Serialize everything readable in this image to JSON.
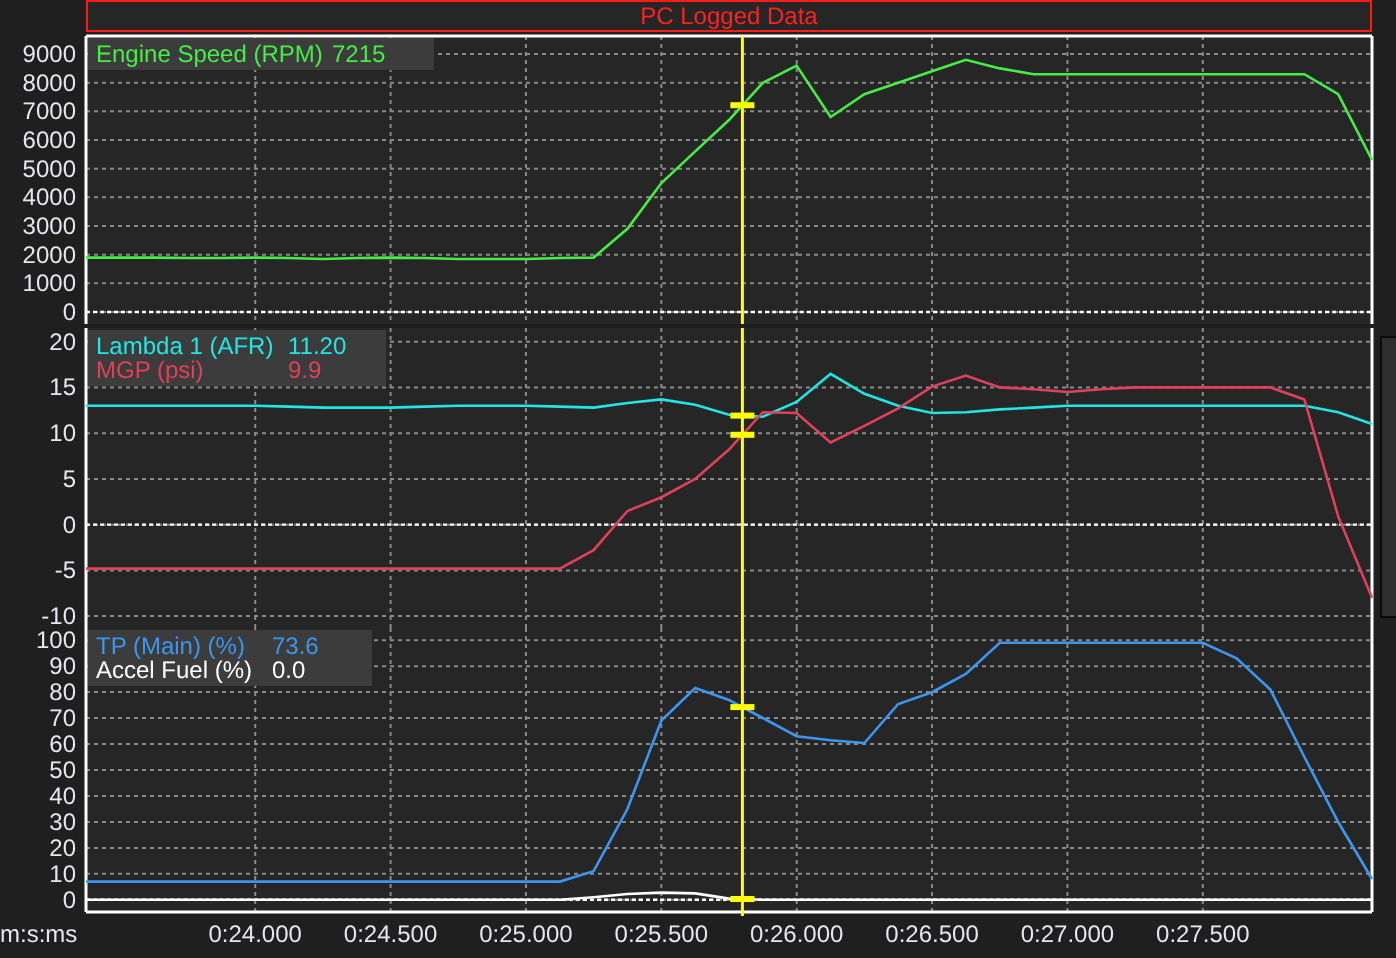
{
  "window": {
    "title": "PC Logged Data"
  },
  "panels": [
    {
      "readings": [
        "7215"
      ],
      "chart_data": {
        "type": "line",
        "series": [
          {
            "name": "Engine Speed (RPM)",
            "color": "#44ee44",
            "values": [
              1900,
              1900,
              1900,
              1880,
              1880,
              1900,
              1880,
              1850,
              1880,
              1900,
              1880,
              1850,
              1850,
              1850,
              1880,
              1900,
              2900,
              4500,
              5600,
              6700,
              8000,
              8600,
              6800,
              7600,
              8000,
              8400,
              8800,
              8500,
              8300,
              8300,
              8300,
              8300,
              8300,
              8300,
              8300,
              8300,
              8300,
              7600,
              5300
            ]
          }
        ],
        "ylim": [
          -420,
          9630
        ],
        "yticks": [
          0,
          1000,
          2000,
          3000,
          4000,
          5000,
          6000,
          7000,
          8000,
          9000
        ],
        "grid": true,
        "ref_lines": [
          {
            "axis": "y",
            "value": 0
          }
        ]
      }
    },
    {
      "readings": [
        "11.20",
        "9.9"
      ],
      "chart_data": {
        "type": "line",
        "series": [
          {
            "name": "Lambda 1 (AFR)",
            "color": "#22e5e5",
            "values": [
              13,
              13,
              13,
              13,
              13,
              13,
              12.9,
              12.8,
              12.8,
              12.8,
              12.9,
              13,
              13,
              13,
              12.9,
              12.8,
              13.3,
              13.7,
              13.1,
              12,
              11.8,
              13.4,
              16.5,
              14.3,
              13,
              12.2,
              12.3,
              12.6,
              12.8,
              13,
              13,
              13,
              13,
              13,
              13,
              13,
              13,
              12.3,
              11
            ]
          },
          {
            "name": "MGP (psi)",
            "color": "#e0405a",
            "values": [
              -4.8,
              -4.8,
              -4.8,
              -4.8,
              -4.8,
              -4.8,
              -4.8,
              -4.8,
              -4.8,
              -4.8,
              -4.8,
              -4.8,
              -4.8,
              -4.8,
              -4.8,
              -2.8,
              1.5,
              3,
              5,
              8.2,
              12.3,
              12.2,
              9,
              10.8,
              12.7,
              15.1,
              16.3,
              15,
              14.8,
              14.5,
              14.8,
              15,
              15,
              15,
              15,
              15,
              13.7,
              0.9,
              -8
            ]
          }
        ],
        "ylim": [
          -11.3,
          21.5
        ],
        "yticks": [
          -10,
          -5,
          0,
          5,
          10,
          15,
          20
        ],
        "grid": true,
        "ref_lines": [
          {
            "axis": "y",
            "value": 0
          }
        ]
      }
    },
    {
      "readings": [
        "73.6",
        "0.0"
      ],
      "chart_data": {
        "type": "line",
        "xlabel": "m:s:ms",
        "categories": [
          null,
          null,
          null,
          null,
          null,
          "0:24.000",
          null,
          null,
          null,
          "0:24.500",
          null,
          null,
          null,
          "0:25.000",
          null,
          null,
          null,
          "0:25.500",
          null,
          null,
          null,
          "0:26.000",
          null,
          null,
          null,
          "0:26.500",
          null,
          null,
          null,
          "0:27.000",
          null,
          null,
          null,
          "0:27.500",
          null,
          null,
          null,
          null,
          null
        ],
        "series": [
          {
            "name": "TP (Main) (%)",
            "color": "#3c96f0",
            "values": [
              7,
              7,
              7,
              7,
              7,
              7,
              7,
              7,
              7,
              7,
              7,
              7,
              7,
              7,
              7,
              11,
              35,
              69,
              81.6,
              77,
              70,
              63,
              61.5,
              60.4,
              75.4,
              80,
              87,
              99,
              99,
              99,
              99,
              99,
              99,
              99,
              93,
              81,
              55,
              30,
              8
            ]
          },
          {
            "name": "Accel Fuel (%)",
            "color": "#ffffff",
            "values": [
              0,
              0,
              0,
              0,
              0,
              0,
              0,
              0,
              0,
              0,
              0,
              0,
              0,
              0,
              0,
              1,
              2.2,
              2.8,
              2.5,
              0.5,
              0,
              0,
              0,
              0,
              0,
              0,
              0,
              0,
              0,
              0,
              0,
              0,
              0,
              0,
              0,
              0,
              0,
              0,
              0
            ]
          }
        ],
        "ylim": [
          -4.7,
          104.7
        ],
        "yticks": [
          0,
          10,
          20,
          30,
          40,
          50,
          60,
          70,
          80,
          90,
          100
        ],
        "grid": true,
        "ref_lines": [
          {
            "axis": "y",
            "value": 0
          }
        ]
      }
    }
  ]
}
